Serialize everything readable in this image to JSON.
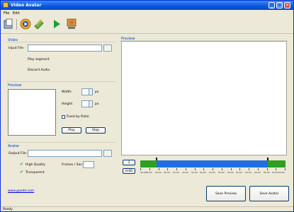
{
  "window": {
    "title": "Video Avatar",
    "minimize": "_",
    "maximize": "□",
    "close": "×"
  },
  "menu": {
    "file": "File",
    "edit": "Edit"
  },
  "toolbar": {
    "items": [
      "open-icon",
      "record-icon",
      "edit-icon",
      "play-icon",
      "film-icon"
    ],
    "colors": {
      "play": "#1fa02f",
      "record": "#f5a623",
      "open": "#4a78c9"
    }
  },
  "video": {
    "group": "Video",
    "input_label": "Input File:",
    "input_value": "",
    "option1": "Play segment",
    "option2": "Discard Audio"
  },
  "preview_group": {
    "group": "Preview",
    "width_label": "Width:",
    "width_unit": "px",
    "height_label": "Height:",
    "height_unit": "px",
    "keep_ratio": "Fixed by Ratio",
    "play_button": "Play",
    "stop_button": "Stop"
  },
  "avatar": {
    "group": "Avatar",
    "output_label": "Output File:",
    "output_value": "",
    "high_quality": "High Quality",
    "frames_label": "Frames / Sec:",
    "frames_value": "",
    "transparent": "Transparent"
  },
  "link": "www.goodd.com",
  "preview_pane": {
    "title": "Preview"
  },
  "timeline": {
    "btn_top": "1",
    "btn_bottom": "0:00",
    "selection_start": 0.11,
    "selection_end": 0.88,
    "ticks": [
      "00:00",
      "00:00",
      "00:00",
      "00:00",
      "00:00",
      "00:00",
      "00:00",
      "00:00",
      "00:00",
      "00:00",
      "00:00",
      "00:00",
      "00:00",
      "00:00",
      "00:00",
      "00:00",
      "00:00"
    ],
    "colors": {
      "selected": "#1f6fe3",
      "unselected": "#2aa11f"
    }
  },
  "buttons": {
    "save_preview": "Save Preview",
    "save_avatar": "Save Avatar"
  },
  "status": {
    "text": "Ready"
  }
}
